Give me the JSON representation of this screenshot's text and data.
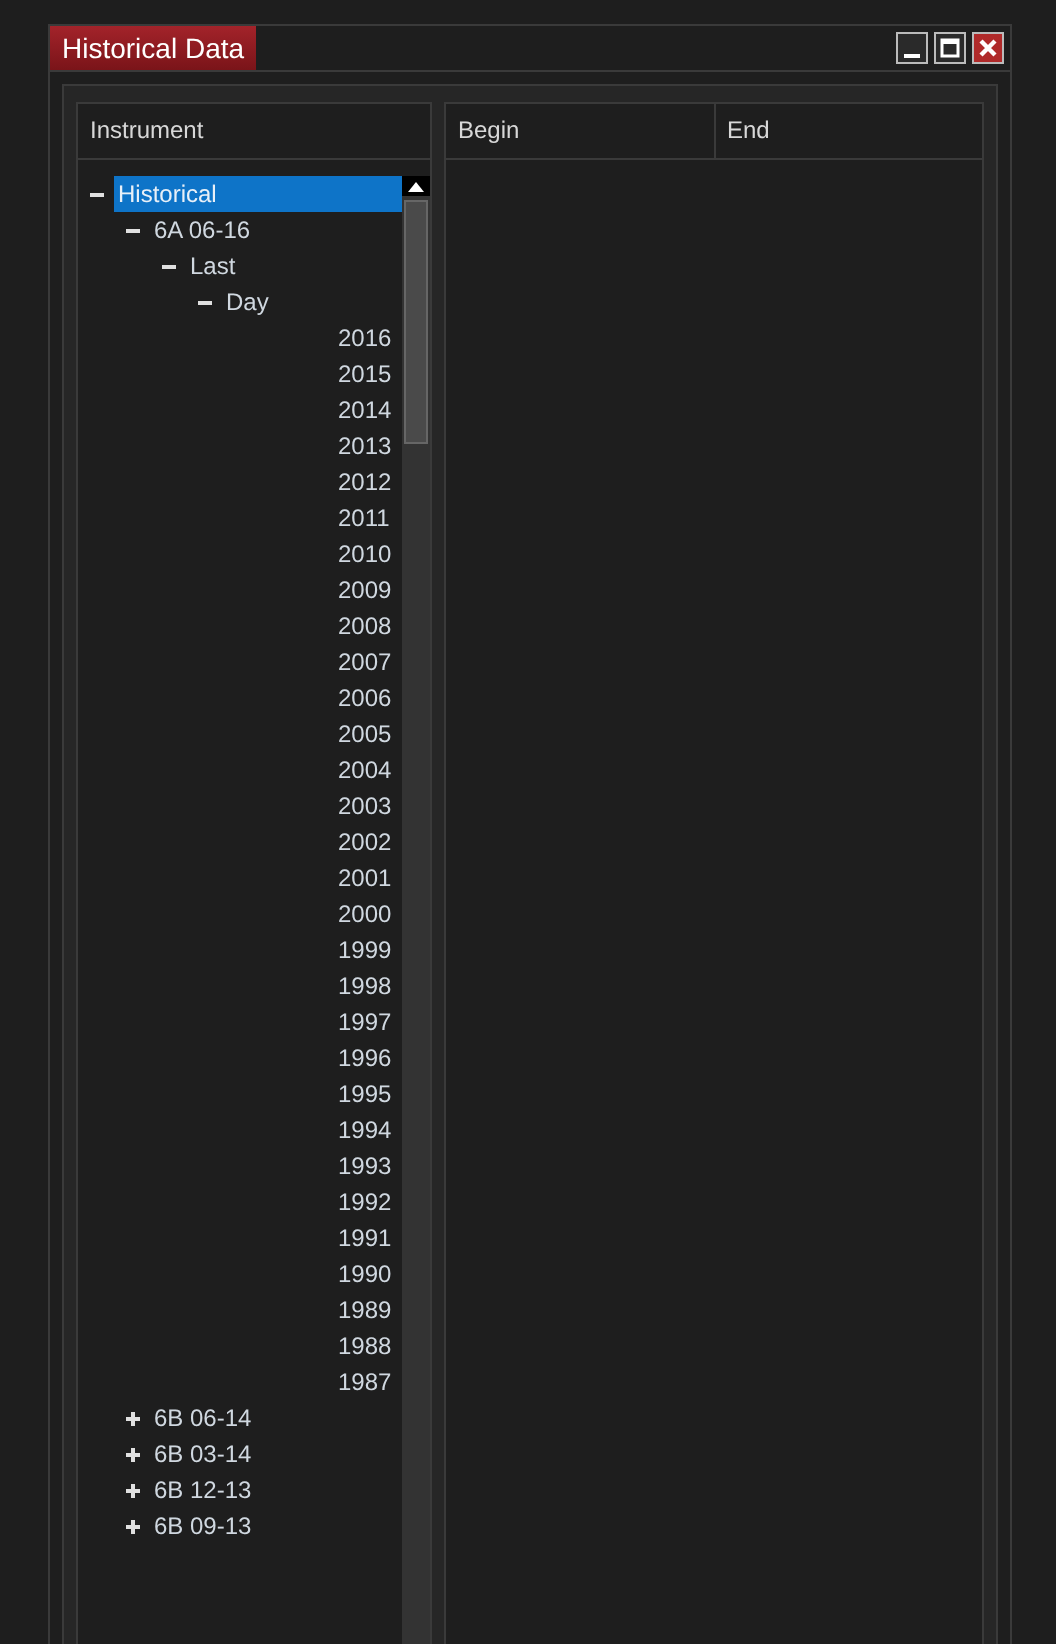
{
  "window": {
    "title": "Historical Data"
  },
  "instrument_panel": {
    "header": "Instrument",
    "tree": [
      {
        "label": "Historical",
        "expanded": true,
        "selected": true,
        "children": [
          {
            "label": "6A 06-16",
            "expanded": true,
            "selected": false,
            "children": [
              {
                "label": "Last",
                "expanded": true,
                "selected": false,
                "children": [
                  {
                    "label": "Day",
                    "expanded": true,
                    "selected": false,
                    "children": [
                      {
                        "label": "2016",
                        "selected": false
                      },
                      {
                        "label": "2015",
                        "selected": false
                      },
                      {
                        "label": "2014",
                        "selected": false
                      },
                      {
                        "label": "2013",
                        "selected": false
                      },
                      {
                        "label": "2012",
                        "selected": false
                      },
                      {
                        "label": "2011",
                        "selected": false
                      },
                      {
                        "label": "2010",
                        "selected": false
                      },
                      {
                        "label": "2009",
                        "selected": false
                      },
                      {
                        "label": "2008",
                        "selected": false
                      },
                      {
                        "label": "2007",
                        "selected": false
                      },
                      {
                        "label": "2006",
                        "selected": false
                      },
                      {
                        "label": "2005",
                        "selected": false
                      },
                      {
                        "label": "2004",
                        "selected": false
                      },
                      {
                        "label": "2003",
                        "selected": false
                      },
                      {
                        "label": "2002",
                        "selected": false
                      },
                      {
                        "label": "2001",
                        "selected": false
                      },
                      {
                        "label": "2000",
                        "selected": false
                      },
                      {
                        "label": "1999",
                        "selected": false
                      },
                      {
                        "label": "1998",
                        "selected": false
                      },
                      {
                        "label": "1997",
                        "selected": false
                      },
                      {
                        "label": "1996",
                        "selected": false
                      },
                      {
                        "label": "1995",
                        "selected": false
                      },
                      {
                        "label": "1994",
                        "selected": false
                      },
                      {
                        "label": "1993",
                        "selected": false
                      },
                      {
                        "label": "1992",
                        "selected": false
                      },
                      {
                        "label": "1991",
                        "selected": false
                      },
                      {
                        "label": "1990",
                        "selected": false
                      },
                      {
                        "label": "1989",
                        "selected": false
                      },
                      {
                        "label": "1988",
                        "selected": false
                      },
                      {
                        "label": "1987",
                        "selected": false
                      }
                    ]
                  }
                ]
              }
            ]
          },
          {
            "label": "6B 06-14",
            "expanded": false,
            "selected": false
          },
          {
            "label": "6B 03-14",
            "expanded": false,
            "selected": false
          },
          {
            "label": "6B 12-13",
            "expanded": false,
            "selected": false
          },
          {
            "label": "6B 09-13",
            "expanded": false,
            "selected": false
          }
        ]
      }
    ]
  },
  "data_table": {
    "columns": [
      "Begin",
      "End"
    ]
  }
}
